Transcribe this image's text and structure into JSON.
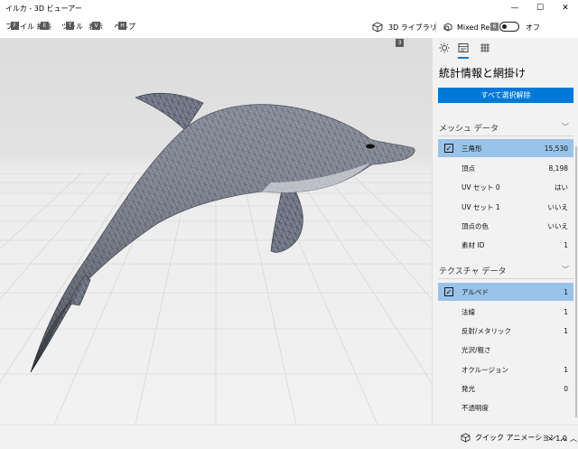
{
  "window": {
    "title": "イルカ - 3D ビューアー",
    "minimize": "—",
    "maximize": "☐",
    "close": "✕"
  },
  "menu": {
    "items": [
      {
        "label": "ファイル",
        "key": "F"
      },
      {
        "label": "編集",
        "key": "E"
      },
      {
        "label": "ツール",
        "key": "T"
      },
      {
        "label": "表示",
        "key": "V"
      },
      {
        "label": "ヘルプ",
        "key": "H"
      }
    ]
  },
  "toolbar": {
    "library_label": "3D ライブラリ",
    "library_key": "3",
    "mixed_reality_label": "Mixed Reality",
    "mixed_reality_key": "6",
    "toggle_state": "オフ"
  },
  "panel": {
    "tabs": [
      "sun-icon",
      "stats-icon",
      "grid-icon"
    ],
    "title": "統計情報と網掛け",
    "deselect_all": "すべて選択解除",
    "mesh_section": {
      "title": "メッシュ データ",
      "rows": [
        {
          "label": "三角形",
          "value": "15,530",
          "selected": true,
          "checked": true
        },
        {
          "label": "頂点",
          "value": "8,198"
        },
        {
          "label": "UV セット 0",
          "value": "はい"
        },
        {
          "label": "UV セット 1",
          "value": "いいえ"
        },
        {
          "label": "頂点の色",
          "value": "いいえ"
        },
        {
          "label": "素材 ID",
          "value": "1"
        }
      ]
    },
    "texture_section": {
      "title": "テクスチャ データ",
      "rows": [
        {
          "label": "アルベド",
          "value": "1",
          "selected": true,
          "checked": true
        },
        {
          "label": "法線",
          "value": "1"
        },
        {
          "label": "反射/メタリック",
          "value": "1"
        },
        {
          "label": "光沢/粗さ",
          "value": ""
        },
        {
          "label": "オクルージョン",
          "value": "1"
        },
        {
          "label": "発光",
          "value": "0"
        },
        {
          "label": "不透明度",
          "value": ""
        }
      ]
    }
  },
  "statusbar": {
    "quick_animation": "クイック アニメーション",
    "speed": "× 1.0"
  },
  "colors": {
    "accent": "#0078d7",
    "selected_row": "#99c3e8",
    "panel_bg": "#f2f2f2"
  }
}
